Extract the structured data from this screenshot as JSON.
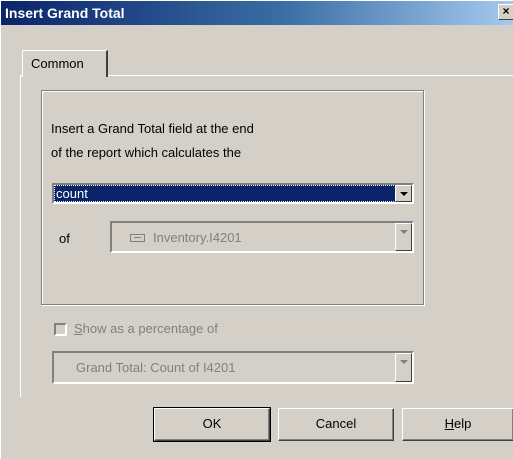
{
  "window": {
    "title": "Insert Grand Total",
    "close_glyph": "×"
  },
  "tabs": [
    {
      "label": "Common"
    }
  ],
  "description": {
    "line1": "Insert a Grand Total field at the end",
    "line2": "of the report which calculates the"
  },
  "function_select": {
    "value": "count"
  },
  "of_label": "of",
  "field_select": {
    "value": "Inventory.I4201",
    "icon": "field-icon"
  },
  "percentage_checkbox": {
    "label_underlined": "S",
    "label_rest": "how as a percentage of",
    "checked": false
  },
  "percentage_select": {
    "value": "Grand Total: Count of I4201"
  },
  "buttons": {
    "ok": "OK",
    "cancel": "Cancel",
    "help_underlined": "H",
    "help_rest": "elp"
  },
  "colors": {
    "title_bar": "#0a246a",
    "selection": "#0a246a",
    "face": "#d4d0c8",
    "disabled_text": "#808080"
  }
}
